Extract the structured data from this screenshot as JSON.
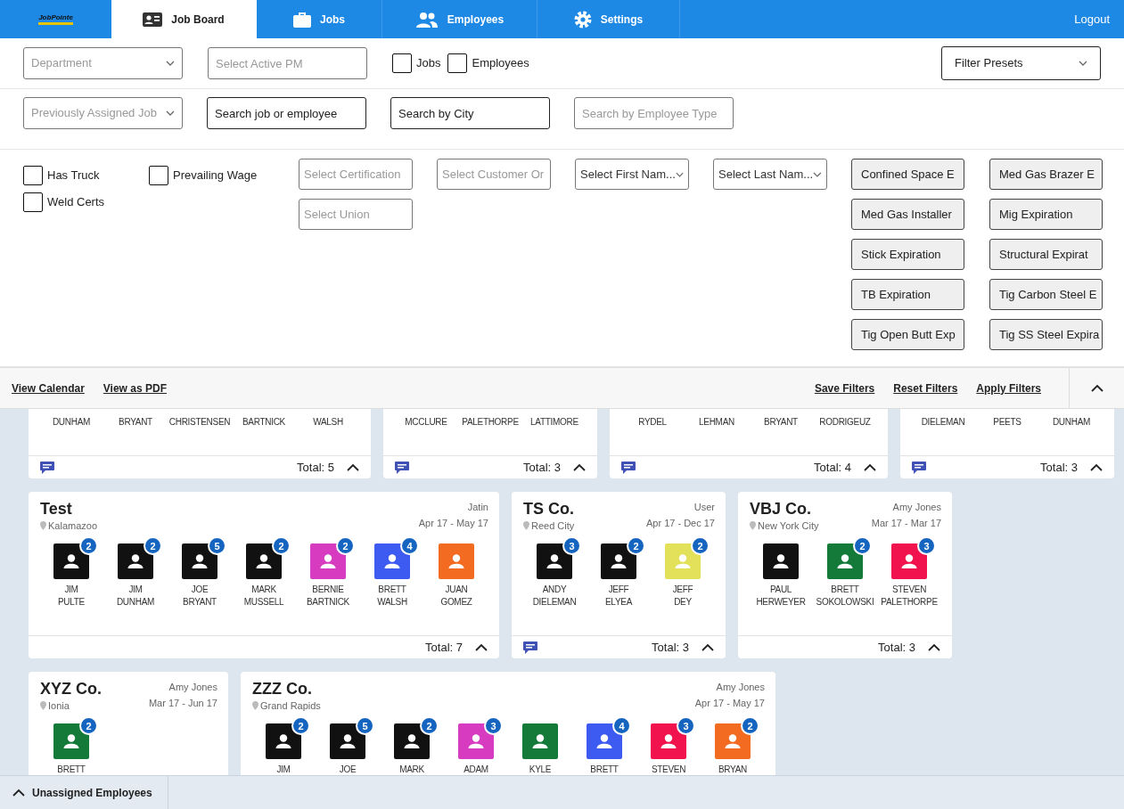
{
  "nav": {
    "logo": "JobPointe",
    "tabs": [
      {
        "label": "Job Board",
        "selected": true
      },
      {
        "label": "Jobs",
        "selected": false
      },
      {
        "label": "Employees",
        "selected": false
      },
      {
        "label": "Settings",
        "selected": false
      }
    ],
    "logout": "Logout"
  },
  "filters": {
    "row1": [
      {
        "kind": "select",
        "placeholder": "Department"
      },
      {
        "kind": "input",
        "placeholder": "Select Active PM"
      },
      {
        "kind": "checkbox",
        "label": "Jobs",
        "checked": false
      },
      {
        "kind": "checkbox",
        "label": "Employees",
        "checked": false
      }
    ],
    "presets": {
      "label": "Filter Presets"
    },
    "row2": [
      {
        "kind": "select",
        "placeholder": "Previously Assigned Job"
      },
      {
        "kind": "search",
        "placeholder": "Search job or employee"
      },
      {
        "kind": "search",
        "placeholder": "Search by City"
      },
      {
        "kind": "input",
        "placeholder": "Search by Employee Type"
      }
    ],
    "checks": [
      {
        "label": "Has Truck",
        "checked": false
      },
      {
        "label": "Prevailing Wage",
        "checked": false
      },
      {
        "label": "Weld Certs",
        "checked": false
      }
    ],
    "columns": [
      [
        {
          "kind": "input",
          "placeholder": "Select Certification"
        },
        {
          "kind": "input",
          "placeholder": "Select Union"
        }
      ],
      [
        {
          "kind": "input",
          "placeholder": "Select Customer Or"
        }
      ],
      [
        {
          "kind": "dark-select",
          "placeholder": "Select First Nam..."
        }
      ],
      [
        {
          "kind": "dark-select",
          "placeholder": "Select Last Nam..."
        }
      ]
    ],
    "certifications": [
      "Confined Space E",
      "Med Gas Brazer E",
      "Med Gas Installer",
      "Mig Expiration",
      "Stick Expiration",
      "Structural Expirat",
      "TB Expiration",
      "Tig Carbon Steel E",
      "Tig Open Butt Exp",
      "Tig SS Steel Expira"
    ]
  },
  "actions": {
    "left": [
      "View Calendar",
      "View as PDF"
    ],
    "right": [
      "Save Filters",
      "Reset Filters",
      "Apply Filters"
    ]
  },
  "jobs": [
    {
      "notes": true,
      "total": "Total: 5",
      "employees": [
        {
          "last": "DUNHAM"
        },
        {
          "last": "BRYANT"
        },
        {
          "last": "CHRISTENSEN"
        },
        {
          "last": "BARTNICK"
        },
        {
          "last": "WALSH"
        }
      ]
    },
    {
      "notes": true,
      "total": "Total: 3",
      "employees": [
        {
          "last": "MCCLURE"
        },
        {
          "last": "PALETHORPE"
        },
        {
          "last": "LATTIMORE"
        }
      ]
    },
    {
      "notes": true,
      "total": "Total: 4",
      "employees": [
        {
          "last": "RYDEL"
        },
        {
          "last": "LEHMAN"
        },
        {
          "last": "BRYANT"
        },
        {
          "last": "RODRIGEUZ"
        }
      ]
    },
    {
      "notes": true,
      "total": "Total: 3",
      "employees": [
        {
          "last": "DIELEMAN"
        },
        {
          "last": "PEETS"
        },
        {
          "last": "DUNHAM"
        }
      ]
    },
    {
      "title": "Test",
      "location": "Kalamazoo",
      "pm": "Jatin",
      "dates": "Apr 17 - May 17",
      "notes": false,
      "total": "Total: 7",
      "employees": [
        {
          "first": "JIM",
          "last": "PULTE",
          "color": "#111111",
          "count": "2"
        },
        {
          "first": "JIM",
          "last": "DUNHAM",
          "color": "#111111",
          "count": "2"
        },
        {
          "first": "JOE",
          "last": "BRYANT",
          "color": "#111111",
          "count": "5"
        },
        {
          "first": "MARK",
          "last": "MUSSELL",
          "color": "#111111",
          "count": "2"
        },
        {
          "first": "BERNIE",
          "last": "BARTNICK",
          "color": "#d63bc0",
          "count": "2"
        },
        {
          "first": "BRETT",
          "last": "WALSH",
          "color": "#3d5af1",
          "count": "4"
        },
        {
          "first": "JUAN",
          "last": "GOMEZ",
          "color": "#f26b21"
        }
      ]
    },
    {
      "title": "TS Co.",
      "location": "Reed City",
      "pm": "User",
      "dates": "Apr 17 - Dec 17",
      "notes": true,
      "total": "Total: 3",
      "employees": [
        {
          "first": "ANDY",
          "last": "DIELEMAN",
          "color": "#111111",
          "count": "3"
        },
        {
          "first": "JEFF",
          "last": "ELYEA",
          "color": "#111111",
          "count": "2"
        },
        {
          "first": "JEFF",
          "last": "DEY",
          "color": "#e3e05a",
          "count": "2"
        }
      ]
    },
    {
      "title": "VBJ Co.",
      "location": "New York City",
      "pm": "Amy Jones",
      "dates": "Mar 17 - Mar 17",
      "notes": false,
      "total": "Total: 3",
      "employees": [
        {
          "first": "PAUL",
          "last": "HERWEYER",
          "color": "#111111"
        },
        {
          "first": "BRETT",
          "last": "SOKOLOWSKI",
          "color": "#137a3a",
          "count": "2"
        },
        {
          "first": "STEVEN",
          "last": "PALETHORPE",
          "color": "#f0134d",
          "count": "3"
        }
      ]
    },
    {
      "title": "XYZ Co.",
      "location": "Ionia",
      "pm": "Amy Jones",
      "dates": "Mar 17 - Jun 17",
      "employees": [
        {
          "first": "BRETT",
          "color": "#137a3a",
          "count": "2"
        }
      ]
    },
    {
      "title": "ZZZ Co.",
      "location": "Grand Rapids",
      "pm": "Amy Jones",
      "dates": "Apr 17 - May 17",
      "employees": [
        {
          "first": "JIM",
          "color": "#111111",
          "count": "2"
        },
        {
          "first": "JOE",
          "color": "#111111",
          "count": "5"
        },
        {
          "first": "MARK",
          "color": "#111111",
          "count": "2"
        },
        {
          "first": "ADAM",
          "color": "#d63bc0",
          "count": "3"
        },
        {
          "first": "KYLE",
          "color": "#137a3a"
        },
        {
          "first": "BRETT",
          "color": "#3d5af1",
          "count": "4"
        },
        {
          "first": "STEVEN",
          "color": "#f0134d",
          "count": "3"
        },
        {
          "first": "BRYAN",
          "color": "#f26b21",
          "count": "2"
        }
      ]
    }
  ],
  "bottom_bar": {
    "label": "Unassigned Employees"
  }
}
